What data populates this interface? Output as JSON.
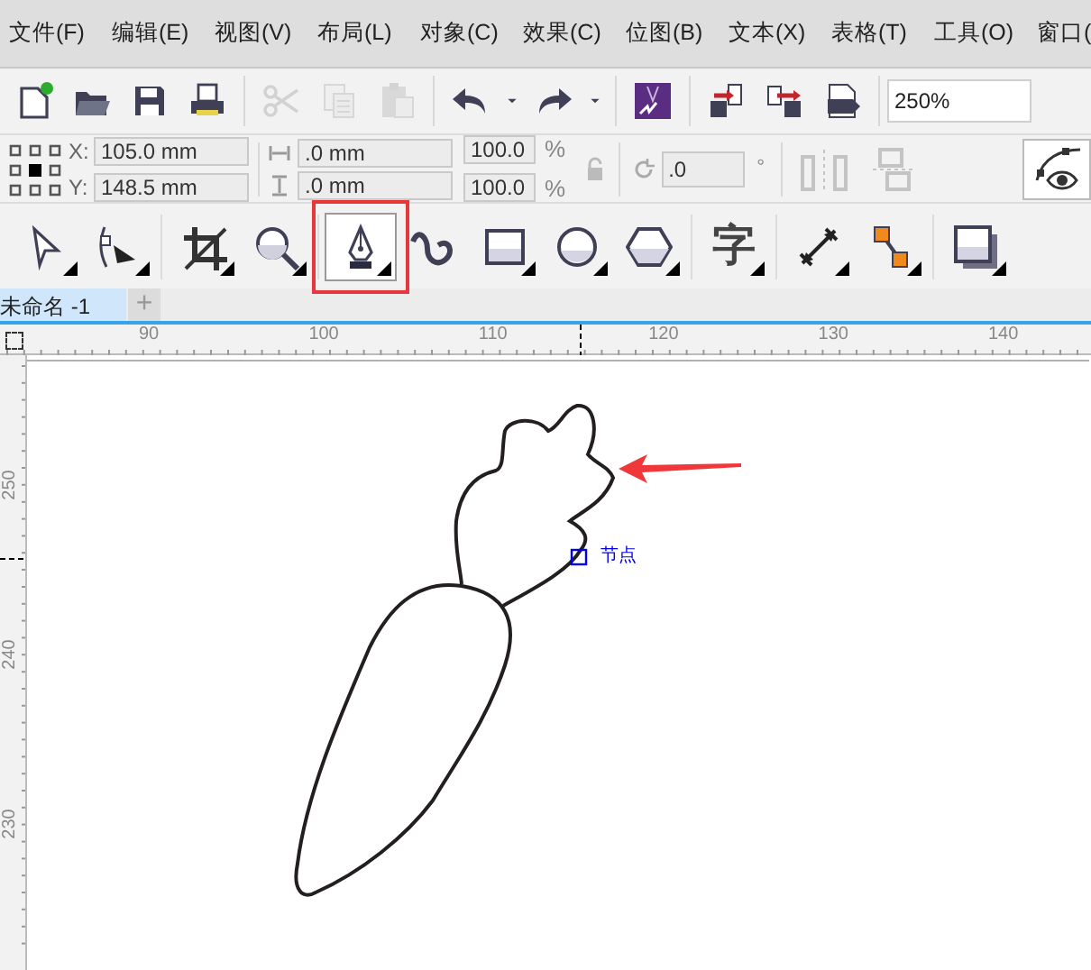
{
  "menu": [
    "文件(F)",
    "编辑(E)",
    "视图(V)",
    "布局(L)",
    "对象(C)",
    "效果(C)",
    "位图(B)",
    "文本(X)",
    "表格(T)",
    "工具(O)",
    "窗口("
  ],
  "toolbar": {
    "groups": [
      [
        {
          "kind": "new",
          "disabled": false
        },
        {
          "kind": "open",
          "disabled": false
        },
        {
          "kind": "save",
          "disabled": false
        },
        {
          "kind": "print",
          "disabled": false
        }
      ],
      [
        {
          "kind": "cut",
          "disabled": true
        },
        {
          "kind": "copy",
          "disabled": true
        },
        {
          "kind": "paste",
          "disabled": true
        }
      ],
      [
        {
          "kind": "undo",
          "disabled": false
        },
        {
          "kind": "caret",
          "disabled": false
        },
        {
          "kind": "redo",
          "disabled": false
        },
        {
          "kind": "caret",
          "disabled": false
        }
      ],
      [
        {
          "kind": "launcher",
          "disabled": false
        }
      ],
      [
        {
          "kind": "import",
          "disabled": false
        },
        {
          "kind": "export",
          "disabled": false
        },
        {
          "kind": "pdf",
          "disabled": false
        }
      ]
    ],
    "zoom": "250%"
  },
  "property_bar": {
    "position": [
      {
        "label": "X:",
        "value": "105.0 mm"
      },
      {
        "label": "Y:",
        "value": "148.5 mm"
      }
    ],
    "size": [
      ".0 mm",
      ".0 mm"
    ],
    "scale": [
      {
        "value": "100.0",
        "unit": "%"
      },
      {
        "value": "100.0",
        "unit": "%"
      }
    ],
    "rotation": {
      "value": ".0",
      "unit": "°"
    }
  },
  "toolbox": [
    {
      "kind": "pick",
      "selected": false,
      "highlighted": false,
      "flyout": true
    },
    {
      "kind": "shape",
      "selected": false,
      "highlighted": false,
      "flyout": true
    },
    {
      "kind": "crop",
      "selected": false,
      "highlighted": false,
      "flyout": true
    },
    {
      "kind": "zoom",
      "selected": false,
      "highlighted": false,
      "flyout": true
    },
    {
      "kind": "pen",
      "selected": true,
      "highlighted": true,
      "flyout": true
    },
    {
      "kind": "artistic",
      "selected": false,
      "highlighted": false,
      "flyout": false
    },
    {
      "kind": "rectangle",
      "selected": false,
      "highlighted": false,
      "flyout": true
    },
    {
      "kind": "ellipse",
      "selected": false,
      "highlighted": false,
      "flyout": true
    },
    {
      "kind": "polygon",
      "selected": false,
      "highlighted": false,
      "flyout": true
    },
    {
      "kind": "text",
      "label": "字",
      "selected": false,
      "highlighted": false,
      "flyout": true
    },
    {
      "kind": "dimension",
      "selected": false,
      "highlighted": false,
      "flyout": true
    },
    {
      "kind": "connector",
      "selected": false,
      "highlighted": false,
      "flyout": true
    },
    {
      "kind": "shadow",
      "selected": false,
      "highlighted": false,
      "flyout": true
    }
  ],
  "document_tabs": [
    {
      "title": "未命名 -1",
      "selected": true
    }
  ],
  "new_tab": "+",
  "rulers": {
    "horizontal": [
      "90",
      "100",
      "110",
      "120",
      "130",
      "140"
    ],
    "vertical": [
      "250",
      "240",
      "230"
    ]
  },
  "canvas": {
    "node_label": "节点",
    "pointer_arrow": true
  }
}
